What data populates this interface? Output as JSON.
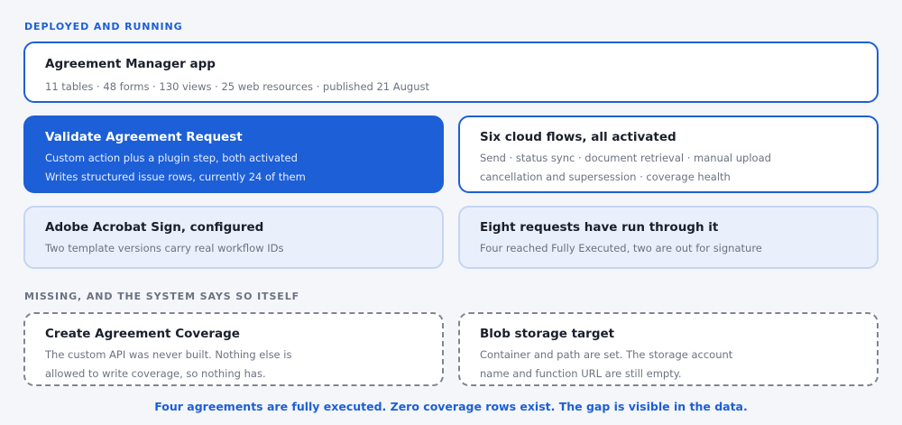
{
  "sections": {
    "deployed_label": "DEPLOYED AND RUNNING",
    "missing_label": "MISSING, AND THE SYSTEM SAYS SO ITSELF"
  },
  "cards": {
    "app": {
      "title": "Agreement Manager app",
      "lines": [
        "11 tables · 48 forms · 130 views · 25 web resources · published 21 August"
      ]
    },
    "validate": {
      "title": "Validate Agreement Request",
      "lines": [
        "Custom action plus a plugin step, both activated",
        "Writes structured issue rows, currently 24 of them"
      ]
    },
    "flows": {
      "title": "Six cloud flows, all activated",
      "lines": [
        "Send · status sync · document retrieval · manual upload",
        "cancellation and supersession · coverage health"
      ]
    },
    "acrobat": {
      "title": "Adobe Acrobat Sign, configured",
      "lines": [
        "Two template versions carry real workflow IDs"
      ]
    },
    "requests": {
      "title": "Eight requests have run through it",
      "lines": [
        "Four reached Fully Executed, two are out for signature"
      ]
    },
    "coverage": {
      "title": "Create Agreement Coverage",
      "lines": [
        "The custom API was never built. Nothing else is",
        "allowed to write coverage, so nothing has."
      ]
    },
    "blob": {
      "title": "Blob storage target",
      "lines": [
        "Container and path are set. The storage account",
        "name and function URL are still empty."
      ]
    }
  },
  "footer": "Four agreements are fully executed. Zero coverage rows exist. The gap is visible in the data.",
  "colors": {
    "accent": "#1d5fd6",
    "background": "#f4f6fa",
    "muted": "#6b7280"
  }
}
